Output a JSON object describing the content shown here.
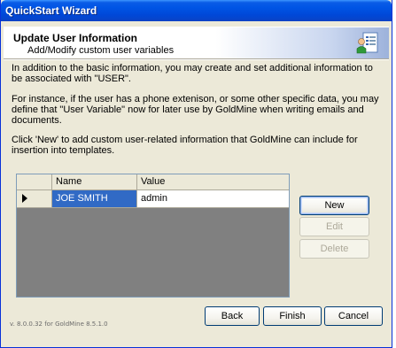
{
  "window": {
    "title": "QuickStart Wizard"
  },
  "header": {
    "title": "Update User Information",
    "subtitle": "Add/Modify custom user variables",
    "icon": "user-list-icon"
  },
  "body": {
    "paragraph1": "In addition to the basic information, you may create and set additional information to be associated with \"USER\".",
    "paragraph2": "For instance, if the user has a phone extenison, or some other specific data, you may define that \"User Variable\" now for later use by GoldMine when writing emails and documents.",
    "paragraph3": "Click 'New' to add custom user-related information that GoldMine can include for insertion into templates."
  },
  "grid": {
    "columns": [
      "Name",
      "Value"
    ],
    "rows": [
      {
        "name": "JOE SMITH",
        "value": "admin",
        "selected": true
      }
    ]
  },
  "side_buttons": {
    "new": "New",
    "edit": "Edit",
    "delete": "Delete"
  },
  "footer": {
    "version": "v. 8.0.0.32 for GoldMine 8.5.1.0",
    "back": "Back",
    "finish": "Finish",
    "cancel": "Cancel"
  },
  "colors": {
    "titlebar": "#0055e5",
    "selection": "#316ac5",
    "grid_background": "#808080",
    "dialog": "#ece9d8"
  }
}
